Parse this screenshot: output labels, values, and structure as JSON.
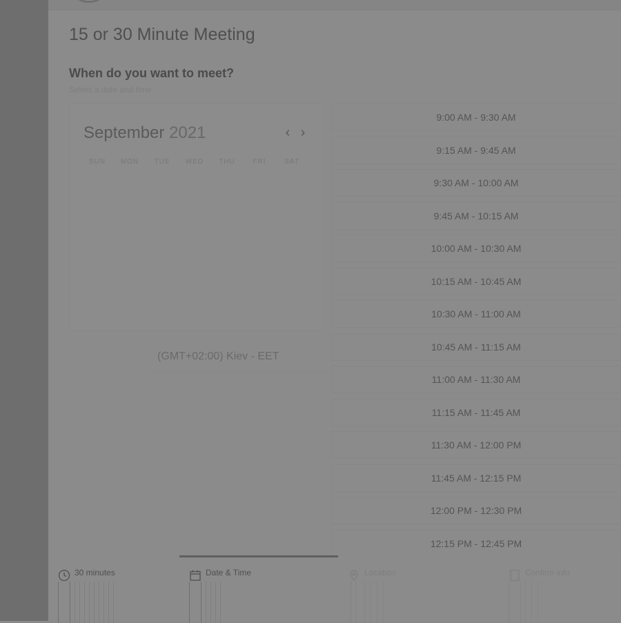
{
  "meeting": {
    "title": "15 or 30 Minute Meeting",
    "question": "When do you want to meet?",
    "subtext": "Select a date and time"
  },
  "calendar": {
    "month": "September",
    "year": "2021",
    "prev_icon": "chevron-left-icon",
    "next_icon": "chevron-right-icon",
    "weekdays": [
      "SUN",
      "MON",
      "TUE",
      "WED",
      "THU",
      "FRI",
      "SAT"
    ]
  },
  "timezone": {
    "label": "(GMT+02:00) Kiev - EET",
    "icon": "chevron-down-icon"
  },
  "time_slots": [
    "9:00 AM - 9:30 AM",
    "9:15 AM - 9:45 AM",
    "9:30 AM - 10:00 AM",
    "9:45 AM - 10:15 AM",
    "10:00 AM - 10:30 AM",
    "10:15 AM - 10:45 AM",
    "10:30 AM - 11:00 AM",
    "10:45 AM - 11:15 AM",
    "11:00 AM - 11:30 AM",
    "11:15 AM - 11:45 AM",
    "11:30 AM - 12:00 PM",
    "11:45 AM - 12:15 PM",
    "12:00 PM - 12:30 PM",
    "12:15 PM - 12:45 PM"
  ],
  "steps": [
    {
      "label": "30 minutes",
      "icon": "clock-icon",
      "active": false
    },
    {
      "label": "Date & Time",
      "icon": "calendar-icon",
      "active": true
    },
    {
      "label": "Location",
      "icon": "location-pin-icon",
      "active": false
    },
    {
      "label": "Confirm info",
      "icon": "document-icon",
      "active": false
    }
  ],
  "colors": {
    "overlay_background": "#8b8b8b",
    "sidebar": "#6e6e6e",
    "active_step_line": "#5f5f5f"
  }
}
